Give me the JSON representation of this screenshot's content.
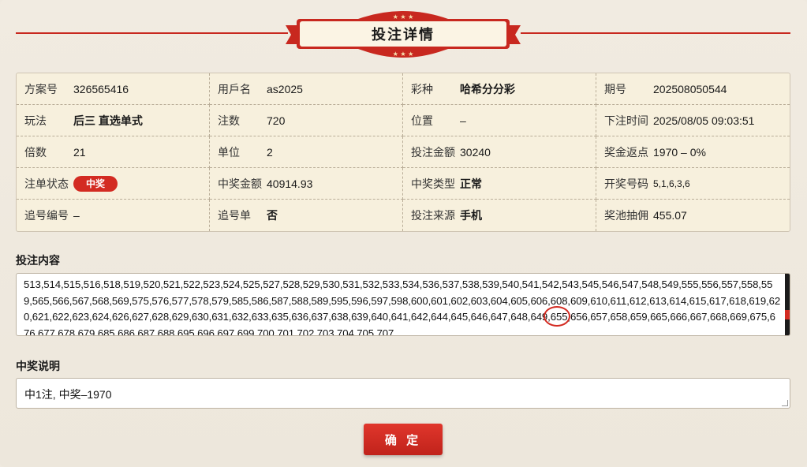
{
  "header": {
    "title": "投注详情"
  },
  "info": [
    [
      {
        "label": "方案号",
        "value": "326565416",
        "bold": false
      },
      {
        "label": "用戶名",
        "value": "as2025",
        "bold": false
      },
      {
        "label": "彩种",
        "value": "哈希分分彩",
        "bold": true
      },
      {
        "label": "期号",
        "value": "202508050544",
        "bold": false
      }
    ],
    [
      {
        "label": "玩法",
        "value": "后三 直选单式",
        "bold": true
      },
      {
        "label": "注数",
        "value": "720",
        "bold": false
      },
      {
        "label": "位置",
        "value": "–",
        "bold": false
      },
      {
        "label": "下注时间",
        "value": "2025/08/05 09:03:51",
        "bold": false
      }
    ],
    [
      {
        "label": "倍数",
        "value": "21",
        "bold": false
      },
      {
        "label": "单位",
        "value": "2",
        "bold": false
      },
      {
        "label": "投注金额",
        "value": "30240",
        "bold": false
      },
      {
        "label": "奖金返点",
        "value": "1970 – 0%",
        "bold": false
      }
    ],
    [
      {
        "label": "注单状态",
        "value": "中奖",
        "badge": true
      },
      {
        "label": "中奖金额",
        "value": "40914.93",
        "bold": false
      },
      {
        "label": "中奖类型",
        "value": "正常",
        "bold": true
      },
      {
        "label": "开奖号码",
        "value": "5,1,6,3,6",
        "small": true
      }
    ],
    [
      {
        "label": "追号编号",
        "value": "–",
        "bold": false
      },
      {
        "label": "追号单",
        "value": "否",
        "bold": true
      },
      {
        "label": "投注来源",
        "value": "手机",
        "bold": true
      },
      {
        "label": "奖池抽佣",
        "value": "455.07",
        "bold": false
      }
    ]
  ],
  "content": {
    "label": "投注内容",
    "numbers": "513,514,515,516,518,519,520,521,522,523,524,525,527,528,529,530,531,532,533,534,536,537,538,539,540,541,542,543,545,546,547,548,549,555,556,557,558,559,565,566,567,568,569,575,576,577,578,579,585,586,587,588,589,595,596,597,598,600,601,602,603,604,605,606,608,609,610,611,612,613,614,615,617,618,619,620,621,622,623,624,626,627,628,629,630,631,632,633,635,636,637,638,639,640,641,642,644,645,646,647,648,649,655,656,657,658,659,665,666,667,668,669,675,676,677,678,679,685,686,687,688,695,696,697,699,700,701,702,703,704,705,707"
  },
  "description": {
    "label": "中奖说明",
    "text": "中1注, 中奖–1970"
  },
  "confirm_label": "确 定",
  "colors": {
    "accent": "#d32b22",
    "panel": "#f7f0dd",
    "background": "#efe9df"
  }
}
